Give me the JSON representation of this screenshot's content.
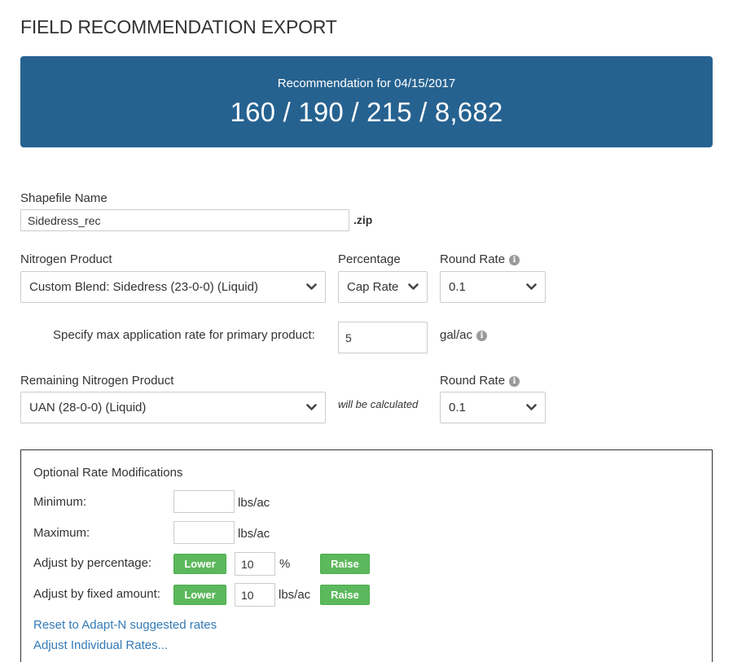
{
  "page": {
    "title": "FIELD RECOMMENDATION EXPORT"
  },
  "banner": {
    "subtitle": "Recommendation for 04/15/2017",
    "values": "160 / 190 / 215 / 8,682"
  },
  "shapefile": {
    "label": "Shapefile Name",
    "value": "Sidedress_rec",
    "extension": ".zip"
  },
  "nitrogen": {
    "product_label": "Nitrogen Product",
    "product_value": "Custom Blend: Sidedress (23-0-0) (Liquid)",
    "percentage_label": "Percentage",
    "percentage_value": "Cap Rate",
    "round_rate_label": "Round Rate",
    "round_rate_value": "0.1",
    "max_rate_label": "Specify max application rate for primary product:",
    "max_rate_value": "5",
    "max_rate_unit": "gal/ac"
  },
  "remaining": {
    "product_label": "Remaining Nitrogen Product",
    "product_value": "UAN (28-0-0) (Liquid)",
    "calc_note": "will be calculated",
    "round_rate_label": "Round Rate",
    "round_rate_value": "0.1"
  },
  "modifications": {
    "title": "Optional Rate Modifications",
    "minimum_label": "Minimum:",
    "minimum_value": "",
    "minimum_unit": "lbs/ac",
    "maximum_label": "Maximum:",
    "maximum_value": "",
    "maximum_unit": "lbs/ac",
    "percent_label": "Adjust by percentage:",
    "percent_value": "10",
    "percent_unit": "%",
    "fixed_label": "Adjust by fixed amount:",
    "fixed_value": "10",
    "fixed_unit": "lbs/ac",
    "lower_label": "Lower",
    "raise_label": "Raise",
    "reset_link": "Reset to Adapt-N suggested rates",
    "individual_link": "Adjust Individual Rates..."
  },
  "icons": {
    "info": "info-icon",
    "dropdown": "chevron-down-icon"
  },
  "colors": {
    "banner": "#266290",
    "button": "#5cb85c",
    "link": "#337ab7"
  }
}
